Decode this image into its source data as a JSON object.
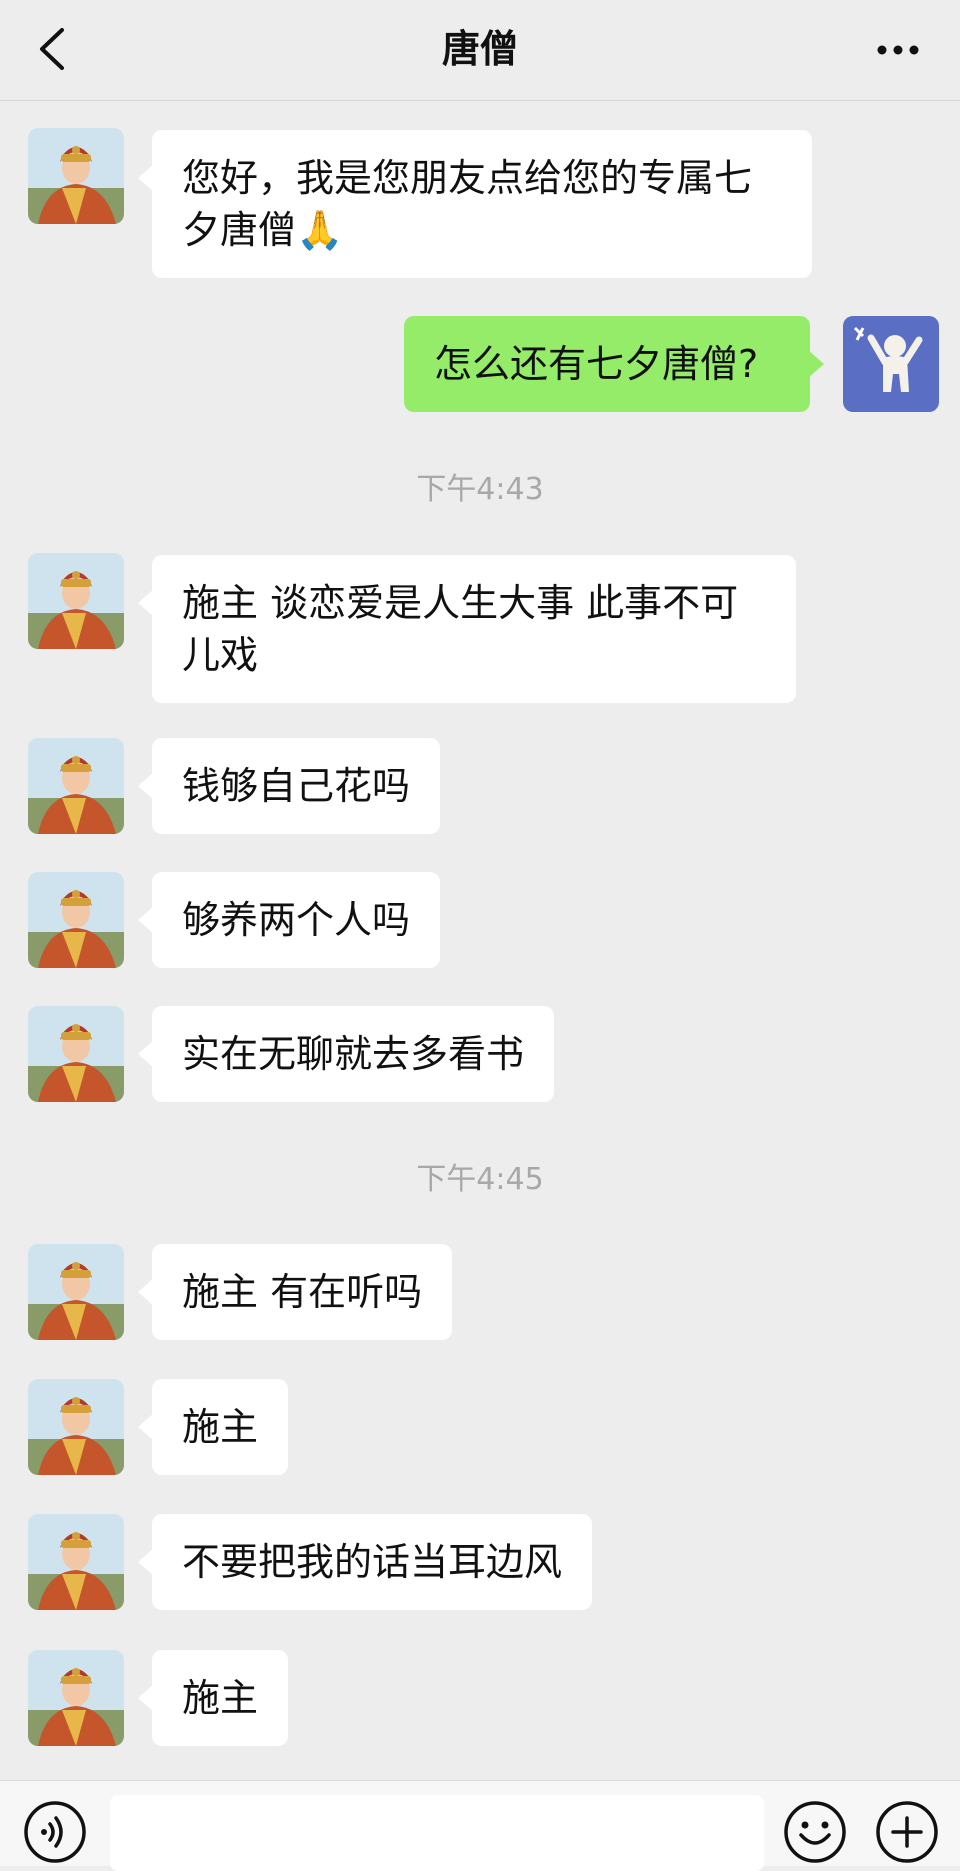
{
  "header": {
    "title": "唐僧",
    "back_icon": "chevron-left-icon",
    "more_icon": "more-dots-icon"
  },
  "messages": [
    {
      "from": "唐僧",
      "text": "您好，我是您朋友点给您的专属七夕唐僧🙏"
    },
    {
      "from": "me",
      "text": "怎么还有七夕唐僧?"
    },
    {
      "time": "下午4:43"
    },
    {
      "from": "唐僧",
      "text": "施主 谈恋爱是人生大事 此事不可儿戏"
    },
    {
      "from": "唐僧",
      "text": "钱够自己花吗"
    },
    {
      "from": "唐僧",
      "text": "够养两个人吗"
    },
    {
      "from": "唐僧",
      "text": "实在无聊就去多看书"
    },
    {
      "time": "下午4:45"
    },
    {
      "from": "唐僧",
      "text": "施主 有在听吗"
    },
    {
      "from": "唐僧",
      "text": "施主"
    },
    {
      "from": "唐僧",
      "text": "不要把我的话当耳边风"
    },
    {
      "from": "唐僧",
      "text": "施主"
    }
  ],
  "input_bar": {
    "voice_icon": "voice-icon",
    "emoji_icon": "emoji-icon",
    "plus_icon": "plus-icon",
    "text": ""
  },
  "colors": {
    "background": "#ededed",
    "incoming_bubble": "#ffffff",
    "outgoing_bubble": "#95ec69",
    "timestamp": "#a8a8a8"
  }
}
